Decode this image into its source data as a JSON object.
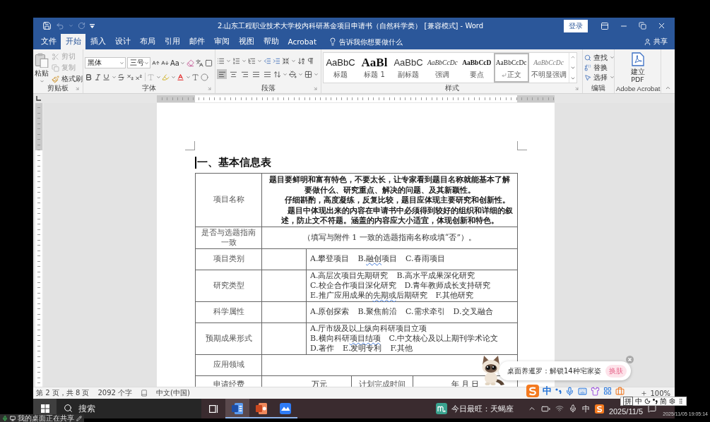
{
  "window": {
    "title": "2.山东工程职业技术大学校内科研基金项目申请书（自然科学类） [兼容模式] - Word",
    "sign_in": "登录"
  },
  "tabs": [
    {
      "label": "文件",
      "selected": false
    },
    {
      "label": "开始",
      "selected": true
    },
    {
      "label": "插入",
      "selected": false
    },
    {
      "label": "设计",
      "selected": false
    },
    {
      "label": "布局",
      "selected": false
    },
    {
      "label": "引用",
      "selected": false
    },
    {
      "label": "邮件",
      "selected": false
    },
    {
      "label": "审阅",
      "selected": false
    },
    {
      "label": "视图",
      "selected": false
    },
    {
      "label": "帮助",
      "selected": false
    },
    {
      "label": "Acrobat",
      "selected": false
    }
  ],
  "tell_me": {
    "placeholder": "告诉我你想要做什么"
  },
  "share": "共享",
  "clipboard": {
    "label": "剪贴板",
    "paste": "粘贴",
    "tools": [
      {
        "kind": "cut",
        "label": "剪切",
        "disabled": true
      },
      {
        "kind": "copy",
        "label": "复制",
        "disabled": true
      },
      {
        "kind": "painter",
        "label": "格式刷",
        "disabled": false
      }
    ]
  },
  "font": {
    "label": "字体",
    "font_name": "黑体",
    "font_size": "三号",
    "change_case": "Aa"
  },
  "paragraph": {
    "label": "段落",
    "alignments": [
      {
        "kind": "left",
        "selected": true
      },
      {
        "kind": "center",
        "selected": false
      },
      {
        "kind": "right",
        "selected": false
      },
      {
        "kind": "justify",
        "selected": false
      },
      {
        "kind": "distributed",
        "selected": false
      }
    ]
  },
  "styles": {
    "label": "样式",
    "items": [
      {
        "kind": "title",
        "preview": "AaBbC",
        "name": "标题",
        "selected": false
      },
      {
        "kind": "heading",
        "preview": "AaBl",
        "name": "标题 1",
        "selected": false
      },
      {
        "kind": "subtitle",
        "preview": "AaBbC",
        "name": "副标题",
        "selected": false
      },
      {
        "kind": "emphasis",
        "preview": "AaBbCcDc",
        "name": "强调",
        "selected": false
      },
      {
        "kind": "strong",
        "preview": "AaBbCcD",
        "name": "要点",
        "selected": false
      },
      {
        "kind": "normal",
        "preview": "AaBbCcDc",
        "name": "正文",
        "selected": true
      },
      {
        "kind": "subtle",
        "preview": "AaBbCcDc",
        "name": "不明显强调",
        "selected": false
      }
    ]
  },
  "editing": {
    "label": "编辑",
    "tools": [
      {
        "kind": "find",
        "label": "查找"
      },
      {
        "kind": "replace",
        "label": "替换"
      },
      {
        "kind": "select",
        "label": "选择"
      }
    ]
  },
  "acrobat": {
    "label": "Adobe Acrobat",
    "create_pdf": "建立 PDF"
  },
  "document": {
    "heading": "一、基本信息表",
    "rows": [
      {
        "kind": "notes",
        "label": "项目名称",
        "paragraphs": [
          "题目要鲜明和富有特色，不要太长，让专家看到题目名称就能基本了解要做什么、研究重点、解决的问题、及其新颖性。",
          "仔细斟酌，高度凝练，反复比较，题目应体现主要研究和创新性。",
          "题目中体现出来的内容在申请书中必须得到较好的组织和详细的叙述，防止文不符题。涵盖的内容应大小适宜，体现创新和特色。"
        ]
      },
      {
        "kind": "merged",
        "label": "是否与选题指南一致",
        "value": "（填写与附件 1 一致的选题指南名称或填“否”）。"
      },
      {
        "kind": "options",
        "label": "项目类别",
        "lines": [
          {
            "options": [
              {
                "parts": [
                  {
                    "text": "A.攀登项目",
                    "underlined": false
                  }
                ]
              },
              {
                "parts": [
                  {
                    "text": "B.",
                    "underlined": false
                  },
                  {
                    "text": "融创",
                    "underlined": true
                  },
                  {
                    "text": "项目",
                    "underlined": false
                  }
                ]
              },
              {
                "parts": [
                  {
                    "text": "C.春雨项目",
                    "underlined": false
                  }
                ]
              }
            ]
          }
        ]
      },
      {
        "kind": "options",
        "label": "研究类型",
        "lines": [
          {
            "options": [
              {
                "parts": [
                  {
                    "text": "A.高层次项目先期研究",
                    "underlined": false
                  }
                ]
              },
              {
                "parts": [
                  {
                    "text": "B.高水平成果深化研究",
                    "underlined": false
                  }
                ]
              }
            ]
          },
          {
            "options": [
              {
                "parts": [
                  {
                    "text": "C.校企合作项目深化研究",
                    "underlined": false
                  }
                ]
              },
              {
                "parts": [
                  {
                    "text": "D.青年教师成长支持研究",
                    "underlined": false
                  }
                ]
              }
            ]
          },
          {
            "options": [
              {
                "parts": [
                  {
                    "text": "E.推广应用成果的",
                    "underlined": false
                  },
                  {
                    "text": "先期或",
                    "underlined": true
                  },
                  {
                    "text": "后期研究",
                    "underlined": false
                  }
                ]
              },
              {
                "parts": [
                  {
                    "text": "F.其他研究",
                    "underlined": false
                  }
                ]
              }
            ]
          }
        ]
      },
      {
        "kind": "options",
        "label": "科学属性",
        "lines": [
          {
            "options": [
              {
                "parts": [
                  {
                    "text": "A.原创探索",
                    "underlined": false
                  }
                ]
              },
              {
                "parts": [
                  {
                    "text": "B.聚焦前沿",
                    "underlined": false
                  }
                ]
              },
              {
                "parts": [
                  {
                    "text": "C.需求牵引",
                    "underlined": false
                  }
                ]
              },
              {
                "parts": [
                  {
                    "text": "D.交叉融合",
                    "underlined": false
                  }
                ]
              }
            ]
          }
        ]
      },
      {
        "kind": "options",
        "label": "预期成果形式",
        "lines": [
          {
            "options": [
              {
                "parts": [
                  {
                    "text": "A.厅市级及以上纵向科研项目立项",
                    "underlined": false
                  }
                ]
              }
            ]
          },
          {
            "options": [
              {
                "parts": [
                  {
                    "text": "B.横向科研",
                    "underlined": false
                  },
                  {
                    "text": "项目结项",
                    "underlined": true
                  }
                ]
              },
              {
                "parts": [
                  {
                    "text": "C.中文核心及以上期刊学术论文",
                    "underlined": false
                  }
                ]
              }
            ]
          },
          {
            "options": [
              {
                "parts": [
                  {
                    "text": "D.著作",
                    "underlined": false
                  }
                ]
              },
              {
                "parts": [
                  {
                    "text": "E.发明专利",
                    "underlined": false
                  }
                ]
              },
              {
                "parts": [
                  {
                    "text": "F.其他",
                    "underlined": false
                  }
                ]
              }
            ]
          }
        ]
      },
      {
        "kind": "merged",
        "label": "应用领域"
      },
      {
        "kind": "budget",
        "label": "申请经费",
        "cells": [
          "万元",
          "计划完成时间",
          "年    月    日"
        ]
      }
    ]
  },
  "status_bar": {
    "page": "第 2 页，共 8 页",
    "words": "2092 个字",
    "language": "中文(中国)",
    "zoom": "100%"
  },
  "taskbar": {
    "search": {
      "placeholder": "搜索"
    },
    "apps": [
      {
        "kind": "word",
        "selected": true
      },
      {
        "kind": "powerpoint",
        "selected": false
      },
      {
        "kind": "meeting",
        "selected": false
      }
    ],
    "widget": "今日最旺：天蝎座",
    "ime": "中",
    "date": "2025/11/5"
  },
  "screen_share": {
    "status": "我的桌面正在共享",
    "timestamp": "2025/11/05 19:05:14"
  },
  "popup": {
    "message": "桌面养暹罗：解锁14种宅家姿",
    "button": "换肤"
  },
  "ime_toolbar": {
    "mode": "中"
  },
  "ime_status": {
    "input": "拼",
    "mode": "中",
    "script": "简"
  }
}
